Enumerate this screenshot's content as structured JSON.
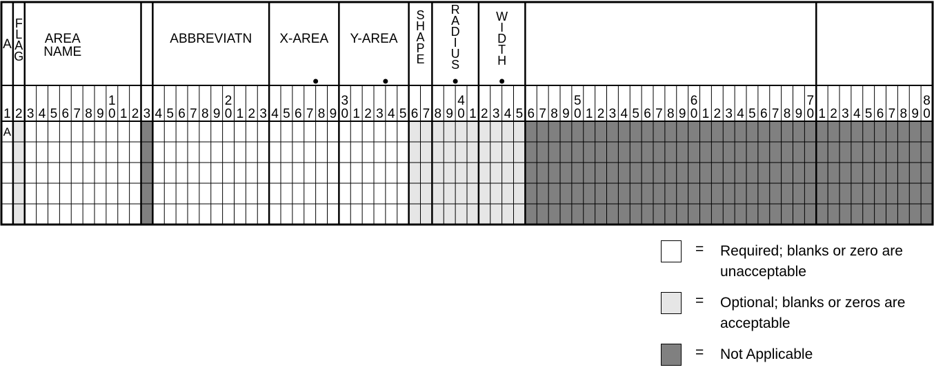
{
  "form": {
    "num_columns": 80,
    "num_data_rows": 5,
    "column_digits": [
      "1",
      "2",
      "3",
      "4",
      "5",
      "6",
      "7",
      "8",
      "9",
      "0",
      "1",
      "2",
      "3",
      "4",
      "5",
      "6",
      "7",
      "8",
      "9",
      "0",
      "1",
      "2",
      "3",
      "4",
      "5",
      "6",
      "7",
      "8",
      "9",
      "0",
      "1",
      "2",
      "3",
      "4",
      "5",
      "6",
      "7",
      "8",
      "9",
      "0",
      "1",
      "2",
      "3",
      "4",
      "5",
      "6",
      "7",
      "8",
      "9",
      "0",
      "1",
      "2",
      "3",
      "4",
      "5",
      "6",
      "7",
      "8",
      "9",
      "0",
      "1",
      "2",
      "3",
      "4",
      "5",
      "6",
      "7",
      "8",
      "9",
      "0",
      "1",
      "2",
      "3",
      "4",
      "5",
      "6",
      "7",
      "8",
      "9",
      "0"
    ],
    "tens_markers": [
      {
        "col": 10,
        "label": "1"
      },
      {
        "col": 20,
        "label": "2"
      },
      {
        "col": 30,
        "label": "3"
      },
      {
        "col": 40,
        "label": "4"
      },
      {
        "col": 50,
        "label": "5"
      },
      {
        "col": 60,
        "label": "6"
      },
      {
        "col": 70,
        "label": "7"
      },
      {
        "col": 80,
        "label": "8"
      }
    ],
    "fields": [
      {
        "name": "card-type",
        "start": 1,
        "end": 1,
        "label": "A",
        "orientation": "horizontal",
        "status": "required",
        "decimal_after": null
      },
      {
        "name": "flag",
        "start": 2,
        "end": 2,
        "label": "FLAG",
        "orientation": "vertical",
        "status": "optional",
        "decimal_after": null
      },
      {
        "name": "area-name",
        "start": 3,
        "end": 12,
        "label": "AREA NAME",
        "orientation": "horizontal",
        "status": "required",
        "decimal_after": null
      },
      {
        "name": "blank-13",
        "start": 13,
        "end": 13,
        "label": "",
        "orientation": "horizontal",
        "status": "not-applicable",
        "decimal_after": null
      },
      {
        "name": "abbreviation",
        "start": 14,
        "end": 23,
        "label": "ABBREVIATN",
        "orientation": "horizontal",
        "status": "required",
        "decimal_after": null
      },
      {
        "name": "x-area",
        "start": 24,
        "end": 29,
        "label": "X-AREA",
        "orientation": "horizontal",
        "status": "required",
        "decimal_after": 27
      },
      {
        "name": "y-area",
        "start": 30,
        "end": 35,
        "label": "Y-AREA",
        "orientation": "horizontal",
        "status": "required",
        "decimal_after": 33
      },
      {
        "name": "shape",
        "start": 36,
        "end": 37,
        "label": "SHAPE",
        "orientation": "vertical",
        "status": "optional",
        "decimal_after": null
      },
      {
        "name": "radius",
        "start": 38,
        "end": 41,
        "label": "RADIUS",
        "orientation": "vertical",
        "status": "optional",
        "decimal_after": 39
      },
      {
        "name": "width",
        "start": 42,
        "end": 45,
        "label": "WIDTH",
        "orientation": "vertical",
        "status": "optional",
        "decimal_after": 43
      },
      {
        "name": "unused-46-70",
        "start": 46,
        "end": 70,
        "label": "",
        "orientation": "horizontal",
        "status": "not-applicable",
        "decimal_after": null
      },
      {
        "name": "unused-71-80",
        "start": 71,
        "end": 80,
        "label": "",
        "orientation": "horizontal",
        "status": "not-applicable",
        "decimal_after": null
      }
    ],
    "first_row_entries": [
      {
        "col": 1,
        "value": "A"
      }
    ]
  },
  "colors": {
    "required": "#ffffff",
    "optional": "#e6e6e6",
    "not_applicable": "#808080",
    "line": "#000000"
  },
  "legend": [
    {
      "status": "required",
      "equals": "=",
      "text": "Required; blanks or zero are unacceptable"
    },
    {
      "status": "optional",
      "equals": "=",
      "text": "Optional; blanks or zeros are acceptable"
    },
    {
      "status": "not-applicable",
      "equals": "=",
      "text": "Not Applicable"
    }
  ]
}
